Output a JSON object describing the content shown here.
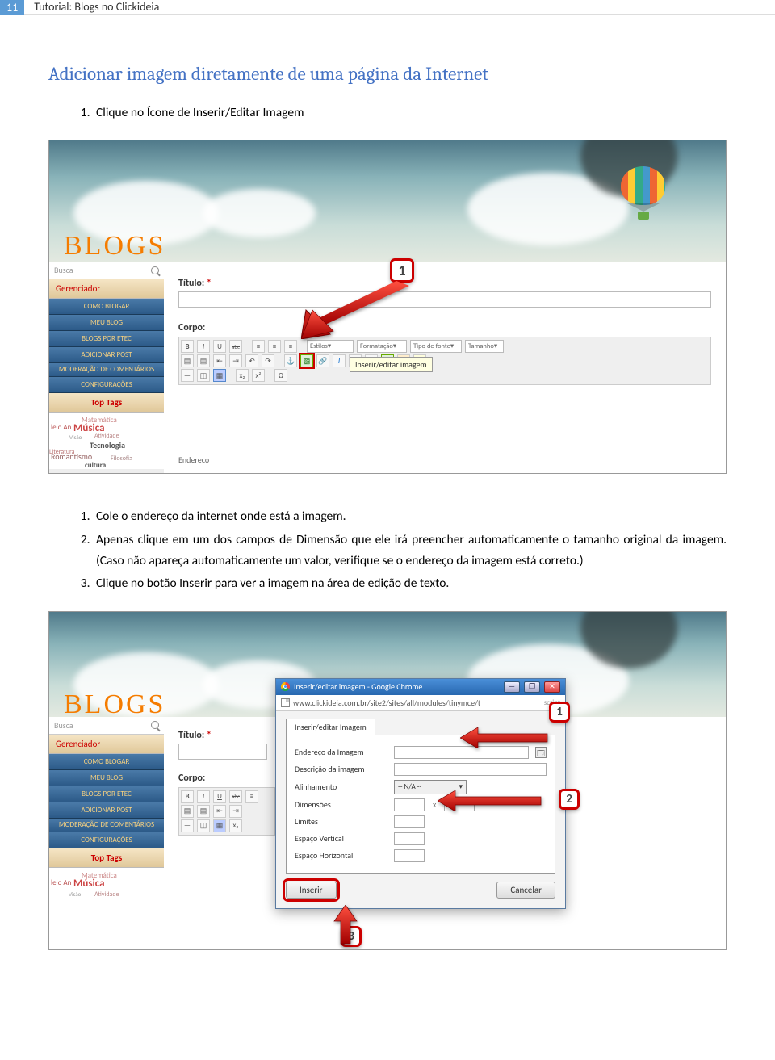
{
  "header": {
    "page_number": "11",
    "title": "Tutorial: Blogs no Clickideia"
  },
  "section_title": "Adicionar imagem diretamente de uma página da Internet",
  "step1": "Clique no Ícone de Inserir/Editar Imagem",
  "instructions2": [
    "Cole o endereço da internet onde está a imagem.",
    "Apenas clique em um dos campos de Dimensão que ele irá preencher automaticamente o tamanho original da imagem. (Caso não apareça automaticamente um valor, verifique se o endereço da imagem está correto.)",
    "Clique no botão Inserir para ver a imagem na área de edição de texto."
  ],
  "blogs_logo": "BLOGS",
  "sidebar": {
    "search_placeholder": "Busca",
    "gerenciador": "Gerenciador",
    "items": [
      "COMO BLOGAR",
      "MEU BLOG",
      "BLOGS POR ETEC",
      "ADICIONAR POST",
      "MODERAÇÃO DE COMENTÁRIOS",
      "CONFIGURAÇÕES"
    ],
    "top_tags": "Top Tags",
    "tags": {
      "matematica": "Matemática",
      "musica": "Música",
      "meio": "leio An",
      "tecnologia": "Tecnologia",
      "atividade": "Atividade",
      "romantismo": "Romantismo",
      "literatura": "Literatura",
      "filosofia": "Filosofia",
      "cultura": "cultura",
      "visao": "Visão"
    }
  },
  "editor": {
    "titulo_label": "Título:",
    "req": "*",
    "corpo_label": "Corpo:",
    "sel_estilos": "Estilos",
    "sel_format": "Formatação",
    "sel_font": "Tipo de fonte",
    "sel_size": "Tamanho",
    "tooltip": "Inserir/editar imagem",
    "endereco": "Endereco",
    "callout1": "1"
  },
  "toolbar_glyphs": {
    "bold": "B",
    "italic": "I",
    "underline": "U",
    "strike": "abc",
    "alignl": "≡",
    "alignc": "≡",
    "alignr": "≡",
    "ul": "▤",
    "ol": "▤",
    "outdent": "⇤",
    "indent": "⇥",
    "undo": "↶",
    "redo": "↷",
    "anchor": "⚓",
    "image": "▧",
    "link": "🔗",
    "ital": "I",
    "at": "@",
    "html": "⬚",
    "color1": "▦",
    "color2": "▦",
    "hr": "—",
    "eraser": "◫",
    "table": "▦",
    "sub": "x₂",
    "sup": "x²",
    "omega": "Ω"
  },
  "popup": {
    "window_title": "Inserir/editar imagem - Google Chrome",
    "url": "www.clickideia.com.br/site2/sites/all/modules/tinymce/t",
    "url_tail": "script",
    "tab": "Inserir/editar Imagem",
    "f_endereco": "Endereço da Imagem",
    "f_descricao": "Descrição da imagem",
    "f_alinhamento": "Alinhamento",
    "f_align_val": "-- N/A --",
    "f_dimensoes": "Dimensões",
    "f_x": "x",
    "f_limites": "Limites",
    "f_espv": "Espaço Vertical",
    "f_esph": "Espaço Horizontal",
    "btn_inserir": "Inserir",
    "btn_cancelar": "Cancelar",
    "callout1": "1",
    "callout2": "2",
    "callout3": "3"
  }
}
